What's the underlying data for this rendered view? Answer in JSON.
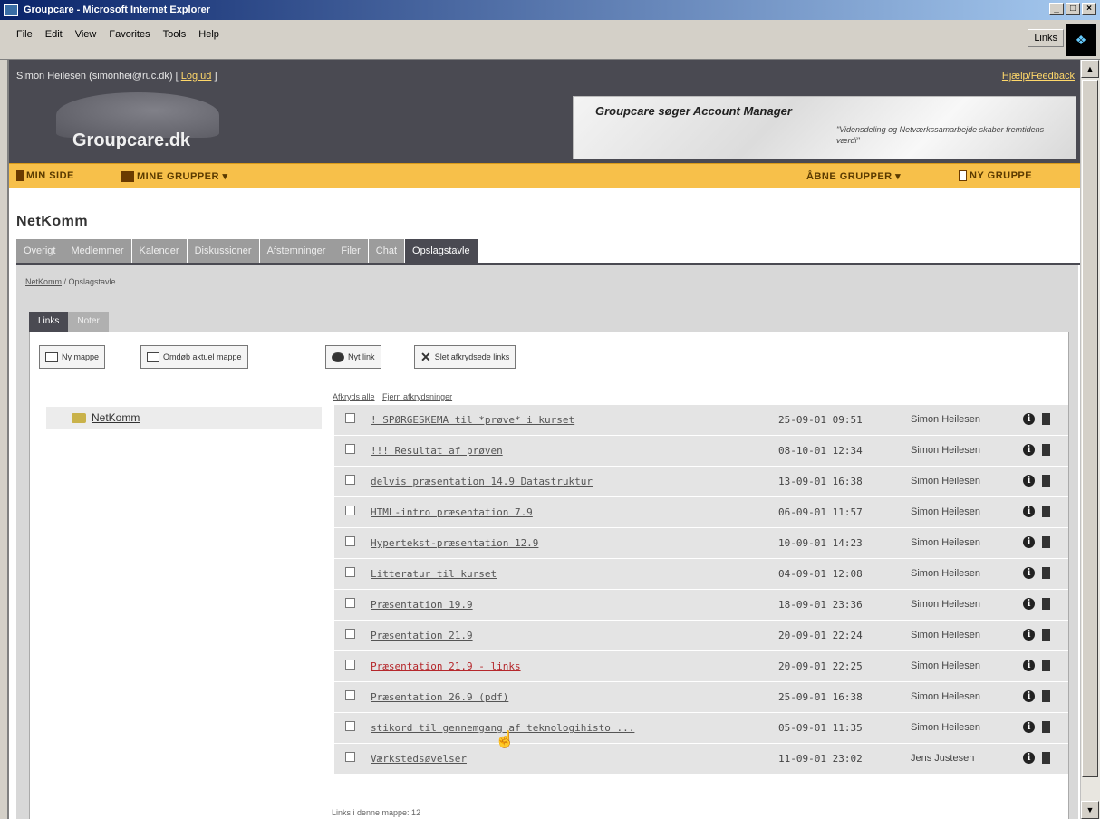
{
  "window": {
    "title": "Groupcare - Microsoft Internet Explorer",
    "min": "_",
    "max": "□",
    "close": "×"
  },
  "menus": [
    "File",
    "Edit",
    "View",
    "Favorites",
    "Tools",
    "Help"
  ],
  "links_label": "Links",
  "header": {
    "user": "Simon Heilesen (simonhei@ruc.dk)",
    "logout": "Log ud",
    "help": "Hjælp/Feedback",
    "logo": "Groupcare.dk",
    "banner_title": "Groupcare søger Account Manager",
    "banner_sub": "\"Vidensdeling og Netværkssamarbejde skaber fremtidens værdi\""
  },
  "nav": {
    "my_page": "MIN SIDE",
    "my_groups": "MINE GRUPPER ▾",
    "open_groups": "ÅBNE GRUPPER ▾",
    "new_group": "NY GRUPPE"
  },
  "group_title": "NetKomm",
  "tabs": [
    "Overigt",
    "Medlemmer",
    "Kalender",
    "Diskussioner",
    "Afstemninger",
    "Filer",
    "Chat",
    "Opslagstavle"
  ],
  "breadcrumb": {
    "root": "NetKomm",
    "current": "Opslagstavle"
  },
  "subtabs": [
    "Links",
    "Noter"
  ],
  "buttons": {
    "new_folder": "Ny mappe",
    "rename_folder": "Omdøb aktuel mappe",
    "new_link": "Nyt link",
    "delete_checked": "Slet afkrydsede links"
  },
  "folder": "NetKomm",
  "check_all": "Afkryds alle",
  "clear_checks": "Fjern afkrydsninger",
  "rows": [
    {
      "title": "! SPØRGESKEMA til *prøve* i kurset",
      "date": "25-09-01 09:51",
      "author": "Simon Heilesen"
    },
    {
      "title": "!!! Resultat af prøven",
      "date": "08-10-01 12:34",
      "author": "Simon Heilesen"
    },
    {
      "title": "delvis præsentation 14.9 Datastruktur",
      "date": "13-09-01 16:38",
      "author": "Simon Heilesen"
    },
    {
      "title": "HTML-intro præsentation 7.9",
      "date": "06-09-01 11:57",
      "author": "Simon Heilesen"
    },
    {
      "title": "Hypertekst-præsentation 12.9",
      "date": "10-09-01 14:23",
      "author": "Simon Heilesen"
    },
    {
      "title": "Litteratur til kurset",
      "date": "04-09-01 12:08",
      "author": "Simon Heilesen"
    },
    {
      "title": "Præsentation 19.9",
      "date": "18-09-01 23:36",
      "author": "Simon Heilesen"
    },
    {
      "title": "Præsentation 21.9",
      "date": "20-09-01 22:24",
      "author": "Simon Heilesen"
    },
    {
      "title": "Præsentation 21.9 - links",
      "date": "20-09-01 22:25",
      "author": "Simon Heilesen"
    },
    {
      "title": "Præsentation 26.9 (pdf)",
      "date": "25-09-01 16:38",
      "author": "Simon Heilesen"
    },
    {
      "title": "stikord til gennemgang af teknologihisto ...",
      "date": "05-09-01 11:35",
      "author": "Simon Heilesen"
    },
    {
      "title": "Værkstedsøvelser",
      "date": "11-09-01 23:02",
      "author": "Jens Justesen"
    }
  ],
  "info_glyph": "i",
  "footer": "Links i denne mappe: 12"
}
